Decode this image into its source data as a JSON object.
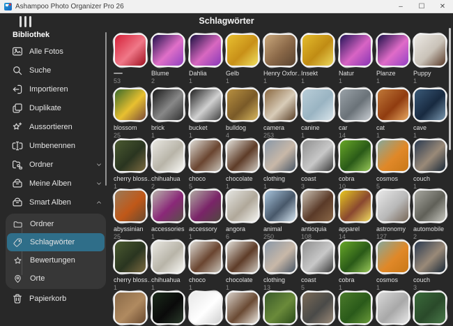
{
  "window": {
    "title": "Ashampoo Photo Organizer Pro 26",
    "controls": {
      "minimize": "–",
      "maximize": "☐",
      "close": "✕"
    }
  },
  "header": {
    "title": "Schlagwörter"
  },
  "colors": {
    "accent": "#2f6e89",
    "background": "#282828",
    "titlebar": "#f1f1f1",
    "sub_group_bg": "#373737"
  },
  "sidebar": {
    "section_label": "Bibliothek",
    "items": [
      {
        "id": "alle-fotos",
        "label": "Alle Fotos",
        "icon": "photos-icon"
      },
      {
        "id": "suche",
        "label": "Suche",
        "icon": "search-icon"
      },
      {
        "id": "importieren",
        "label": "Importieren",
        "icon": "import-icon"
      },
      {
        "id": "duplikate",
        "label": "Duplikate",
        "icon": "duplicates-icon"
      },
      {
        "id": "aussortieren",
        "label": "Aussortieren",
        "icon": "sort-out-icon"
      },
      {
        "id": "umbenennen",
        "label": "Umbenennen",
        "icon": "rename-icon"
      },
      {
        "id": "ordner",
        "label": "Ordner",
        "icon": "folder-tree-icon",
        "chevron": "down"
      },
      {
        "id": "meine-alben",
        "label": "Meine Alben",
        "icon": "album-icon",
        "chevron": "down"
      },
      {
        "id": "smart-alben",
        "label": "Smart Alben",
        "icon": "album-icon",
        "chevron": "up"
      }
    ],
    "smart_children": [
      {
        "id": "smart-ordner",
        "label": "Ordner",
        "icon": "folder-icon",
        "selected": false
      },
      {
        "id": "schlagwoerter",
        "label": "Schlagwörter",
        "icon": "tag-icon",
        "selected": true
      },
      {
        "id": "bewertungen",
        "label": "Bewertungen",
        "icon": "star-icon",
        "selected": false
      },
      {
        "id": "orte",
        "label": "Orte",
        "icon": "pin-icon",
        "selected": false
      }
    ],
    "bottom_item": {
      "id": "papierkorb",
      "label": "Papierkorb",
      "icon": "trash-icon"
    }
  },
  "tags": {
    "rows": [
      [
        {
          "label": "",
          "count": "53",
          "colors": [
            "#d42038",
            "#f07888",
            "#a01020"
          ]
        },
        {
          "label": "Blume",
          "count": "2",
          "colors": [
            "#20104a",
            "#e070c8",
            "#9040c0"
          ]
        },
        {
          "label": "Dahlia",
          "count": "1",
          "colors": [
            "#1a1040",
            "#d868c0",
            "#8838b8"
          ]
        },
        {
          "label": "Gelb",
          "count": "1",
          "colors": [
            "#e8c030",
            "#c89018",
            "#f0e060"
          ]
        },
        {
          "label": "Henry Oxfor…",
          "count": "1",
          "colors": [
            "#caa87c",
            "#8a6848",
            "#5a4430"
          ]
        },
        {
          "label": "Insekt",
          "count": "1",
          "colors": [
            "#e4bc2c",
            "#c08c14",
            "#ecd85c"
          ]
        },
        {
          "label": "Natur",
          "count": "1",
          "colors": [
            "#241458",
            "#d864c4",
            "#8834b4"
          ]
        },
        {
          "label": "Planze",
          "count": "1",
          "colors": [
            "#1c1048",
            "#e06cc8",
            "#9440c4"
          ]
        },
        {
          "label": "Puppy",
          "count": "1",
          "colors": [
            "#ece9e4",
            "#c9c2b8",
            "#5a3a28"
          ]
        }
      ],
      [
        {
          "label": "blossom",
          "count": "25",
          "colors": [
            "#3a6a2a",
            "#e8c030",
            "#7a4a3a"
          ]
        },
        {
          "label": "brick",
          "count": "1",
          "colors": [
            "#181818",
            "#888888",
            "#303030"
          ]
        },
        {
          "label": "bucket",
          "count": "1",
          "colors": [
            "#202020",
            "#d0d0d0",
            "#404040"
          ]
        },
        {
          "label": "bulldog",
          "count": "4",
          "colors": [
            "#b89040",
            "#7a5a28",
            "#d8b860"
          ]
        },
        {
          "label": "camera",
          "count": "253",
          "colors": [
            "#8a6840",
            "#d8ccb8",
            "#5a4028"
          ]
        },
        {
          "label": "canine",
          "count": "1",
          "colors": [
            "#b8cdd8",
            "#9ab4c2",
            "#d8e4ea"
          ]
        },
        {
          "label": "car",
          "count": "14",
          "colors": [
            "#9aa2a8",
            "#6a7278",
            "#c8cdd2"
          ]
        },
        {
          "label": "cat",
          "count": "1",
          "colors": [
            "#c07838",
            "#903c10",
            "#e8a860"
          ]
        },
        {
          "label": "cave",
          "count": "1",
          "colors": [
            "#3a5a78",
            "#182a40",
            "#7a98b0"
          ]
        }
      ],
      [
        {
          "label": "cherry bloss…",
          "count": "1",
          "colors": [
            "#4a5a30",
            "#2a3520",
            "#7a6a40"
          ]
        },
        {
          "label": "chihuahua",
          "count": "2",
          "colors": [
            "#e8e6e0",
            "#b8b4a8",
            "#f8f8f4"
          ]
        },
        {
          "label": "choco",
          "count": "5",
          "colors": [
            "#dedbd4",
            "#6a4530",
            "#c8c2b8"
          ]
        },
        {
          "label": "chocolate",
          "count": "1",
          "colors": [
            "#e2dfd8",
            "#5e3c28",
            "#cfc9c0"
          ]
        },
        {
          "label": "clothing",
          "count": "1",
          "colors": [
            "#8a98a8",
            "#c8b8a8",
            "#4a5868"
          ]
        },
        {
          "label": "coast",
          "count": "3",
          "colors": [
            "#909090",
            "#c8c8c8",
            "#383838"
          ]
        },
        {
          "label": "cobra",
          "count": "10",
          "colors": [
            "#68a828",
            "#2a5a18",
            "#98c858"
          ]
        },
        {
          "label": "cosmos",
          "count": "5",
          "colors": [
            "#88a89a",
            "#e08828",
            "#c87818"
          ]
        },
        {
          "label": "couch",
          "count": "1",
          "colors": [
            "#2a3a50",
            "#9a8a78",
            "#182838"
          ]
        }
      ],
      [
        {
          "label": "abyssinian",
          "count": "25",
          "colors": [
            "#9a7a58",
            "#c05818",
            "#6a4a30"
          ]
        },
        {
          "label": "accessories",
          "count": "1",
          "colors": [
            "#b8b2aa",
            "#8a2878",
            "#585048"
          ]
        },
        {
          "label": "accessory",
          "count": "1",
          "colors": [
            "#b0aaa2",
            "#7a2468",
            "#504840"
          ]
        },
        {
          "label": "angora",
          "count": "6",
          "colors": [
            "#e4e4e0",
            "#b0a89a",
            "#f4f4f0"
          ]
        },
        {
          "label": "animal",
          "count": "250",
          "colors": [
            "#a8c4dc",
            "#48586a",
            "#d8e8f4"
          ]
        },
        {
          "label": "antioquia",
          "count": "108",
          "colors": [
            "#ccc2b4",
            "#5a3a28",
            "#8a6848"
          ]
        },
        {
          "label": "apparel",
          "count": "14",
          "colors": [
            "#e8c820",
            "#8a4830",
            "#f0dc60"
          ]
        },
        {
          "label": "astronomy",
          "count": "127",
          "colors": [
            "#e8e8e8",
            "#b8b8b8",
            "#786858"
          ]
        },
        {
          "label": "automobile",
          "count": "2",
          "colors": [
            "#a8a8a0",
            "#606058",
            "#c8c8c0"
          ]
        }
      ],
      [
        {
          "label": "cherry bloss…",
          "count": "1",
          "colors": [
            "#4a5a30",
            "#2a3520",
            "#7a6a40"
          ]
        },
        {
          "label": "chihuahua",
          "count": "1",
          "colors": [
            "#e8e6e0",
            "#b8b4a8",
            "#f8f8f4"
          ]
        },
        {
          "label": "choco",
          "count": "1",
          "colors": [
            "#dedbd4",
            "#6a4530",
            "#c8c2b8"
          ]
        },
        {
          "label": "chocolate",
          "count": "1",
          "colors": [
            "#e2dfd8",
            "#5e3c28",
            "#cfc9c0"
          ]
        },
        {
          "label": "clothing",
          "count": "13",
          "colors": [
            "#8a98a8",
            "#c8b8a8",
            "#4a5868"
          ]
        },
        {
          "label": "coast",
          "count": "5",
          "colors": [
            "#909090",
            "#c8c8c8",
            "#383838"
          ]
        },
        {
          "label": "cobra",
          "count": "1",
          "colors": [
            "#68a828",
            "#2a5a18",
            "#98c858"
          ]
        },
        {
          "label": "cosmos",
          "count": "1",
          "colors": [
            "#88a89a",
            "#e08828",
            "#c87818"
          ]
        },
        {
          "label": "couch",
          "count": "3",
          "colors": [
            "#2a3a50",
            "#9a8a78",
            "#182838"
          ]
        }
      ]
    ],
    "partial_row": [
      {
        "colors": [
          "#8a6a48",
          "#b08a60",
          "#6a4a30"
        ]
      },
      {
        "colors": [
          "#1a2a1a",
          "#0a0a0a",
          "#2a3a2a"
        ]
      },
      {
        "colors": [
          "#e8e8e8",
          "#ffffff",
          "#d0d0d0"
        ]
      },
      {
        "colors": [
          "#d8d0c8",
          "#6a4a33",
          "#ece8e0"
        ]
      },
      {
        "colors": [
          "#3a5a2a",
          "#6a8a3a",
          "#2a4a1a"
        ]
      },
      {
        "colors": [
          "#7a6a58",
          "#4a4a48",
          "#9a8a78"
        ]
      },
      {
        "colors": [
          "#4a7a2a",
          "#2a5a1a",
          "#6a9a3a"
        ]
      },
      {
        "colors": [
          "#d8d8d8",
          "#a8a8a8",
          "#e8e8e8"
        ]
      },
      {
        "colors": [
          "#3a6a3a",
          "#2a4a2a",
          "#4a7a4a"
        ]
      }
    ]
  }
}
